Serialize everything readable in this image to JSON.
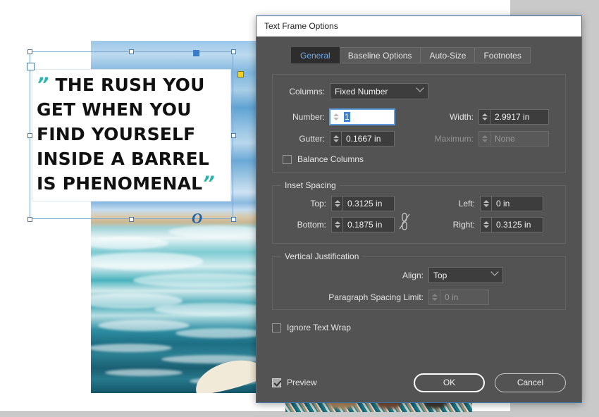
{
  "document": {
    "quote_open": "”",
    "quote_close": "”",
    "quote_lines": [
      "THE RUSH YOU",
      "GET WHEN YOU",
      "FIND YOURSELF",
      "INSIDE A BARREL",
      "IS PHENOMENAL"
    ],
    "logo_letter": "O",
    "accent_color": "#2ab4ad",
    "selection_color": "#7ba7cf",
    "handle_yellow": "#f2d024"
  },
  "dialog": {
    "title": "Text Frame Options",
    "tabs": [
      {
        "label": "General",
        "active": true
      },
      {
        "label": "Baseline Options",
        "active": false
      },
      {
        "label": "Auto-Size",
        "active": false
      },
      {
        "label": "Footnotes",
        "active": false
      }
    ],
    "columns_group": {
      "columns_label": "Columns:",
      "columns_value": "Fixed Number",
      "number_label": "Number:",
      "number_value": "1",
      "width_label": "Width:",
      "width_value": "2.9917 in",
      "gutter_label": "Gutter:",
      "gutter_value": "0.1667 in",
      "maximum_label": "Maximum:",
      "maximum_value": "None",
      "balance_label": "Balance Columns",
      "balance_checked": false
    },
    "inset_group": {
      "title": "Inset Spacing",
      "top_label": "Top:",
      "top_value": "0.3125 in",
      "bottom_label": "Bottom:",
      "bottom_value": "0.1875 in",
      "left_label": "Left:",
      "left_value": "0 in",
      "right_label": "Right:",
      "right_value": "0.3125 in",
      "link_icon": "broken-chain-icon"
    },
    "vertical_group": {
      "title": "Vertical Justification",
      "align_label": "Align:",
      "align_value": "Top",
      "spacing_limit_label": "Paragraph Spacing Limit:",
      "spacing_limit_value": "0 in"
    },
    "ignore_text_wrap": {
      "label": "Ignore Text Wrap",
      "checked": false
    },
    "footer": {
      "preview_label": "Preview",
      "preview_checked": true,
      "ok_label": "OK",
      "cancel_label": "Cancel"
    }
  }
}
